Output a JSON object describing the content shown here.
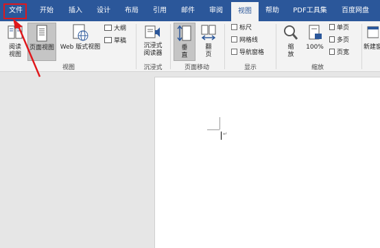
{
  "tabs": [
    "文件",
    "开始",
    "插入",
    "设计",
    "布局",
    "引用",
    "邮件",
    "审阅",
    "视图",
    "帮助",
    "PDF工具集",
    "百度网盘"
  ],
  "active_tab": "视图",
  "ribbon": {
    "views_group": {
      "label": "视图",
      "read_mode": [
        "阅读",
        "视图"
      ],
      "print_layout": "页面视图",
      "web_layout": [
        "Web 版式视图"
      ],
      "outline": "大纲",
      "draft": "草稿"
    },
    "immersive_group": {
      "label": "沉浸式",
      "immersive_reader": [
        "沉浸式",
        "阅读器"
      ]
    },
    "page_move_group": {
      "label": "页面移动",
      "vertical": [
        "垂",
        "直"
      ],
      "side_to_side": [
        "翻",
        "页"
      ]
    },
    "show_group": {
      "label": "显示",
      "ruler": "标尺",
      "gridlines": "网格线",
      "nav_pane": "导航窗格"
    },
    "zoom_group": {
      "label": "缩放",
      "zoom": [
        "缩",
        "放"
      ],
      "zoom_100": "100%",
      "one_page": "单页",
      "multiple_pages": "多页",
      "page_width": "页宽"
    },
    "window_group": {
      "new_window": "新建窗"
    }
  },
  "colors": {
    "tab_bar": "#2b579a",
    "ribbon": "#f3f3f3",
    "annotation": "#e0171b"
  }
}
